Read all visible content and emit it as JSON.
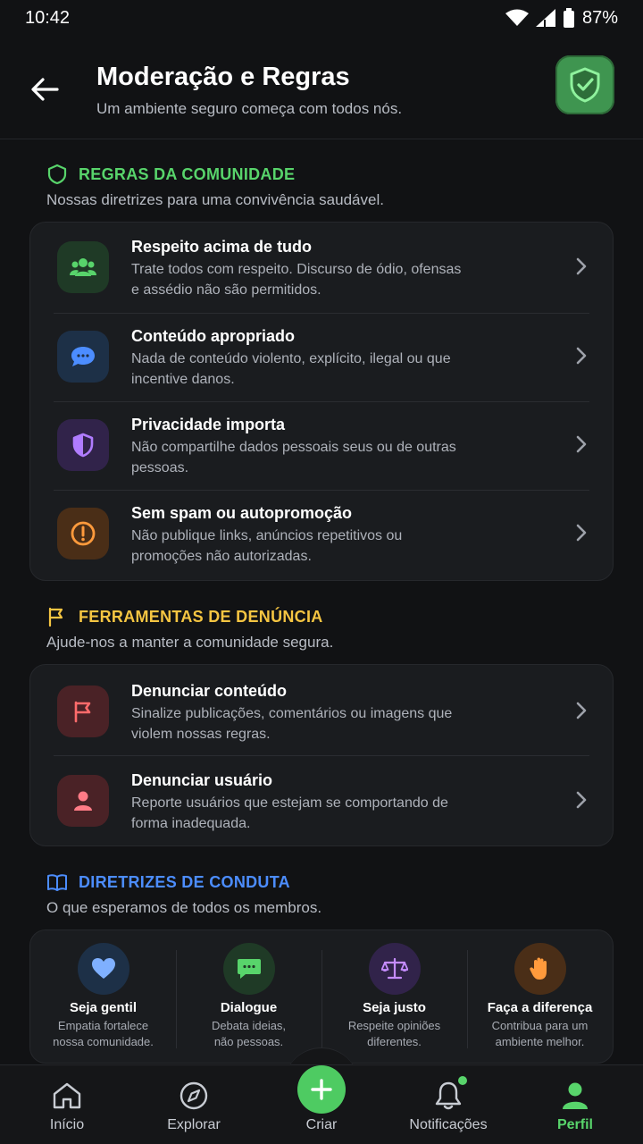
{
  "status_bar": {
    "time": "10:42",
    "battery": "87%"
  },
  "header": {
    "title": "Moderação e Regras",
    "subtitle": "Um ambiente seguro começa com todos nós."
  },
  "community_rules": {
    "heading": "REGRAS DA COMUNIDADE",
    "subtitle": "Nossas diretrizes para uma convivência saudável.",
    "items": [
      {
        "title": "Respeito acima de tudo",
        "desc": "Trate todos com respeito. Discurso de ódio, ofensas e assédio não são permitidos.",
        "icon": "users-icon"
      },
      {
        "title": "Conteúdo apropriado",
        "desc": "Nada de conteúdo violento, explícito, ilegal ou que incentive danos.",
        "icon": "chat-bubble-icon"
      },
      {
        "title": "Privacidade importa",
        "desc": "Não compartilhe dados pessoais seus ou de outras pessoas.",
        "icon": "shield-icon"
      },
      {
        "title": "Sem spam ou autopromoção",
        "desc": "Não publique links, anúncios repetitivos ou promoções não autorizadas.",
        "icon": "alert-circle-icon"
      }
    ]
  },
  "report_tools": {
    "heading": "FERRAMENTAS DE DENÚNCIA",
    "subtitle": "Ajude-nos a manter a comunidade segura.",
    "items": [
      {
        "title": "Denunciar conteúdo",
        "desc": "Sinalize publicações, comentários ou imagens que violem nossas regras.",
        "icon": "flag-icon"
      },
      {
        "title": "Denunciar usuário",
        "desc": "Reporte usuários que estejam se comportando de forma inadequada.",
        "icon": "user-icon"
      }
    ]
  },
  "conduct": {
    "heading": "DIRETRIZES DE CONDUTA",
    "subtitle": "O que esperamos de todos os membros.",
    "items": [
      {
        "title": "Seja gentil",
        "desc_line1": "Empatia fortalece",
        "desc_line2": "nossa comunidade.",
        "icon": "heart-icon"
      },
      {
        "title": "Dialogue",
        "desc_line1": "Debata ideias,",
        "desc_line2": "não pessoas.",
        "icon": "message-icon"
      },
      {
        "title": "Seja justo",
        "desc_line1": "Respeite opiniões",
        "desc_line2": "diferentes.",
        "icon": "scale-icon"
      },
      {
        "title": "Faça a diferença",
        "desc_line1": "Contribua para um",
        "desc_line2": "ambiente melhor.",
        "icon": "hand-icon"
      }
    ]
  },
  "nav": {
    "home": "Início",
    "explore": "Explorar",
    "create": "Criar",
    "notifications": "Notificações",
    "profile": "Perfil",
    "active": "profile"
  },
  "colors": {
    "accent_green": "#58d46b",
    "accent_yellow": "#f5c542",
    "accent_blue": "#4c8dff",
    "background": "#111214",
    "card": "#1a1c1f"
  }
}
